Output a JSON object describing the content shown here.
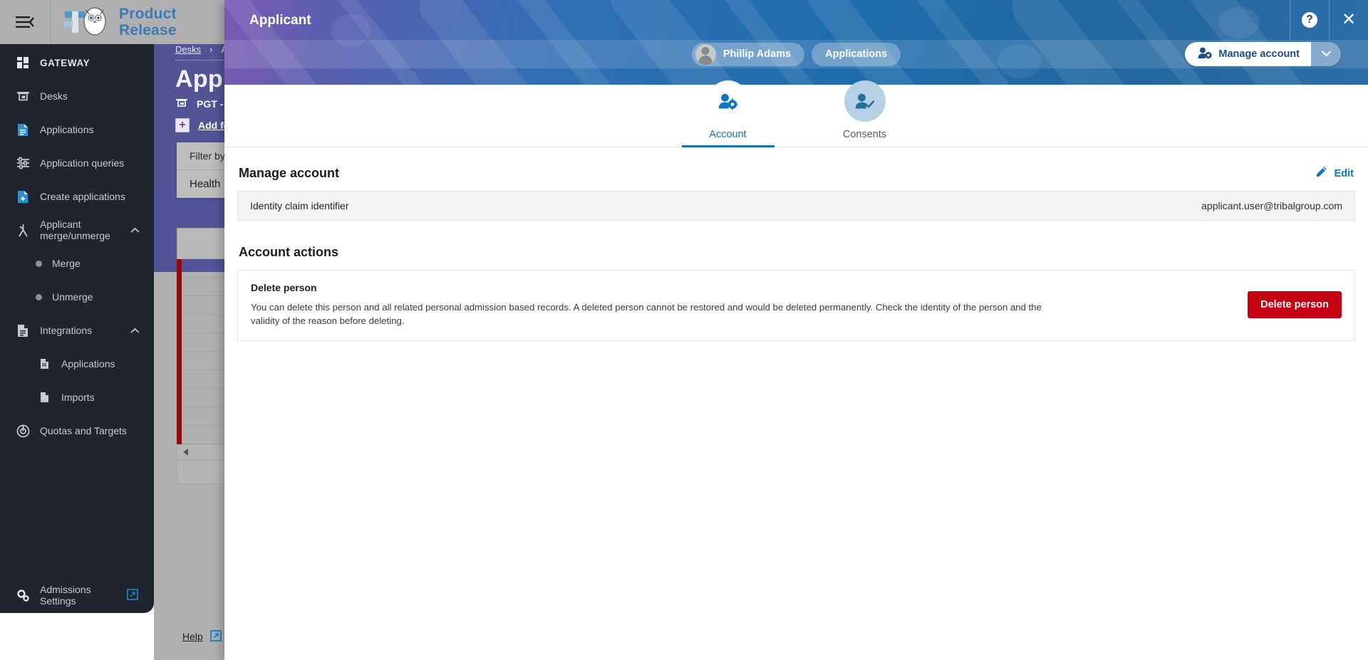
{
  "background": {
    "topbar": {
      "menu_icon": "hamburger-collapse-icon",
      "brand_line1": "Product",
      "brand_line2": "Release"
    },
    "sidebar": {
      "header": "GATEWAY",
      "items": [
        {
          "label": "Desks",
          "icon": "desk-icon",
          "level": 0
        },
        {
          "label": "Applications",
          "icon": "document-icon",
          "level": 0
        },
        {
          "label": "Application queries",
          "icon": "filters-icon",
          "level": 0
        },
        {
          "label": "Create applications",
          "icon": "document-plus-icon",
          "level": 0
        },
        {
          "label": "Applicant merge/unmerge",
          "icon": "merge-icon",
          "level": 0,
          "expanded": true
        },
        {
          "label": "Merge",
          "icon": "bullet-dot-icon",
          "level": 1
        },
        {
          "label": "Unmerge",
          "icon": "bullet-dot-icon",
          "level": 1
        },
        {
          "label": "Integrations",
          "icon": "document-lines-icon",
          "level": 0,
          "expanded": true
        },
        {
          "label": "Applications",
          "icon": "document-small-icon",
          "level": 1
        },
        {
          "label": "Imports",
          "icon": "document-blank-icon",
          "level": 1
        },
        {
          "label": "Quotas and Targets",
          "icon": "target-icon",
          "level": 0
        }
      ],
      "footer": {
        "label": "Admissions Settings",
        "icon": "gears-icon",
        "external_icon": "external-link-icon"
      }
    },
    "page": {
      "breadcrumb_first": "Desks",
      "breadcrumb_sep": "›",
      "breadcrumb_second": "App",
      "title": "Applic",
      "desk_label": "PGT - F",
      "add_label": "Add fo",
      "filter_placeholder": "Filter by key",
      "filter_item": "Health"
    },
    "footer": {
      "help_label": "Help",
      "external_icon": "external-link-icon"
    }
  },
  "modal": {
    "title": "Applicant",
    "help_icon": "help-circle-icon",
    "close_icon": "close-icon",
    "person_chip": "Phillip Adams",
    "applications_chip": "Applications",
    "manage_account_label": "Manage account",
    "manage_account_icon": "user-gear-icon",
    "manage_account_caret": "chevron-down-icon",
    "tabs": [
      {
        "label": "Account",
        "icon": "user-gear-icon",
        "active": true
      },
      {
        "label": "Consents",
        "icon": "user-check-icon",
        "active": false
      }
    ],
    "manage_account_section": {
      "title": "Manage account",
      "edit_label": "Edit",
      "edit_icon": "pencil-icon",
      "claim_label": "Identity claim identifier",
      "claim_value": "applicant.user@tribalgroup.com"
    },
    "account_actions_section": {
      "title": "Account actions",
      "delete_title": "Delete person",
      "delete_description": "You can delete this person and all related personal admission based records. A deleted person cannot be restored and would be deleted permanently. Check the identity of the person and the validity of the reason before deleting.",
      "delete_button": "Delete person"
    }
  },
  "colors": {
    "accent_blue": "#1076bc",
    "danger_red": "#c40013",
    "sidebar_bg": "#20242e",
    "header_blue": "#1f6dad",
    "header_purple": "#7b59b5"
  }
}
